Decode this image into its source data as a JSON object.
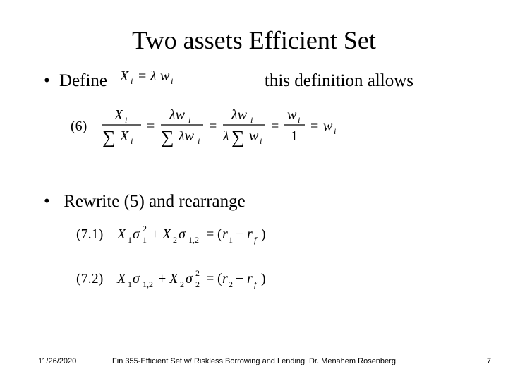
{
  "title": "Two assets Efficient Set",
  "bullet1_prefix": "Define",
  "bullet1_suffix": "this definition allows",
  "bullet2": "Rewrite (5) and rearrange",
  "eq_label_6": "(6)",
  "eq_label_71": "(7.1)",
  "eq_label_72": "(7.2)",
  "footer": {
    "date": "11/26/2020",
    "center": "Fin 355-Efficient Set w/ Riskless Borrowing and Lending| Dr. Menahem Rosenberg",
    "page": "7"
  }
}
